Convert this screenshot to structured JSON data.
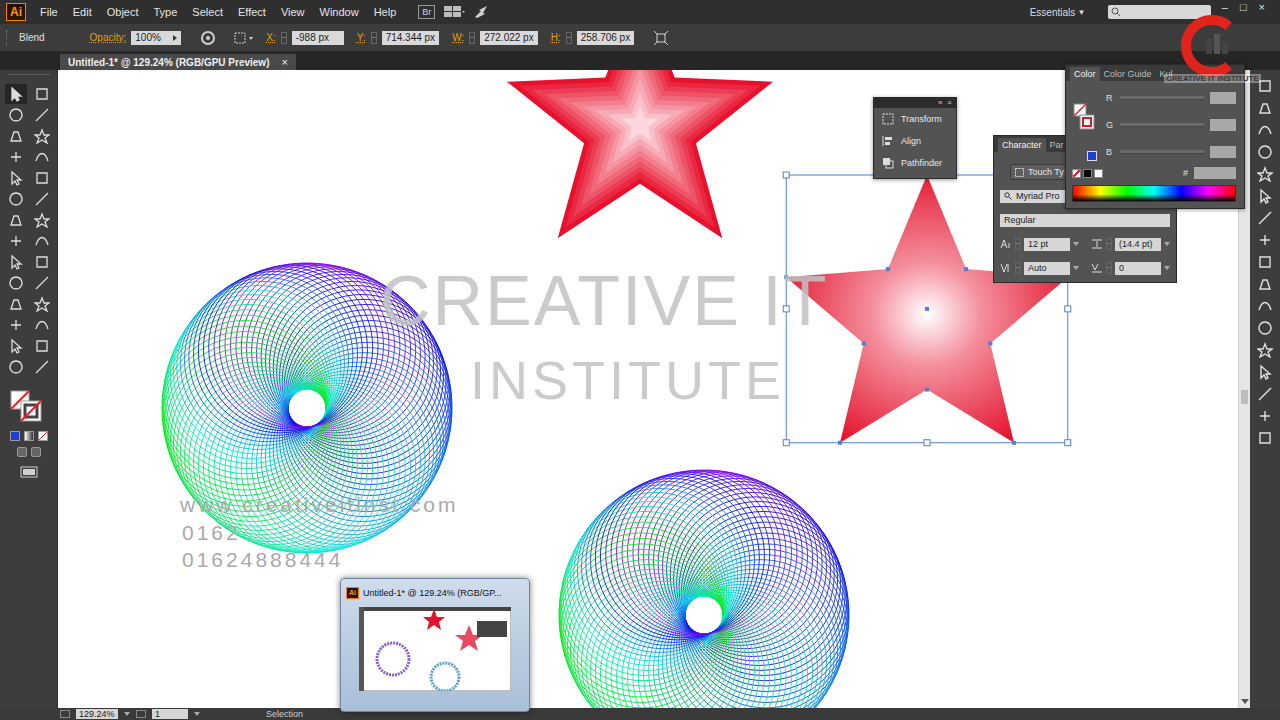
{
  "menubar": {
    "logo": "Ai",
    "menus": [
      "File",
      "Edit",
      "Object",
      "Type",
      "Select",
      "Effect",
      "View",
      "Window",
      "Help"
    ],
    "bridge": "Br",
    "workspace": "Essentials",
    "workspace_arrow": "▾",
    "window_controls": [
      "–",
      "□",
      "×"
    ]
  },
  "control_bar": {
    "object_type": "Blend",
    "opacity_label": "Opacity:",
    "opacity_value": "100%",
    "fields": [
      {
        "label": "X:",
        "value": "-988 px"
      },
      {
        "label": "Y:",
        "value": "714.344 px"
      },
      {
        "label": "W:",
        "value": "272.022 px"
      },
      {
        "label": "H:",
        "value": "258.706 px"
      }
    ]
  },
  "document_tab": {
    "title": "Untitled-1* @ 129.24% (RGB/GPU Preview)",
    "close": "×",
    "selected": true
  },
  "artwork": [
    {
      "kind": "blend-star",
      "selected": false
    },
    {
      "kind": "gradient-star",
      "selected": true
    },
    {
      "kind": "spirograph",
      "selected": false
    },
    {
      "kind": "spirograph",
      "selected": false
    }
  ],
  "watermark": {
    "title": "CREATIVE IT",
    "subtitle": "INSTITUTE",
    "url": "www.creativeitinst.com",
    "phones": [
      "0162",
      "01624888444"
    ]
  },
  "panels": {
    "tools_panel": {
      "header_icons": [
        "»",
        "×"
      ],
      "items": [
        "Transform",
        "Align",
        "Pathfinder"
      ]
    },
    "character": {
      "tabs": [
        {
          "label": "Character",
          "selected": true
        },
        {
          "label": "Par",
          "selected": false
        }
      ],
      "touch_type": "Touch Ty",
      "font_family": "Myriad Pro",
      "font_style": "Regular",
      "size": "12 pt",
      "leading": "(14.4 pt)",
      "kerning": "Auto",
      "tracking": "0"
    },
    "color": {
      "tabs": [
        {
          "label": "Color",
          "selected": true
        },
        {
          "label": "Color Guide",
          "selected": false
        },
        {
          "label": "Kul",
          "selected": false
        }
      ],
      "channels": [
        "R",
        "G",
        "B"
      ],
      "hex_label": "#"
    }
  },
  "logo": {
    "text": "CREATIVE IT INSTITUTE"
  },
  "status_bar": {
    "zoom": "129.24%",
    "artboard": "1",
    "tool": "Selection"
  },
  "taskbar_preview": {
    "icon": "Ai",
    "title": "Untitled-1* @ 129.24% (RGB/GP..."
  }
}
